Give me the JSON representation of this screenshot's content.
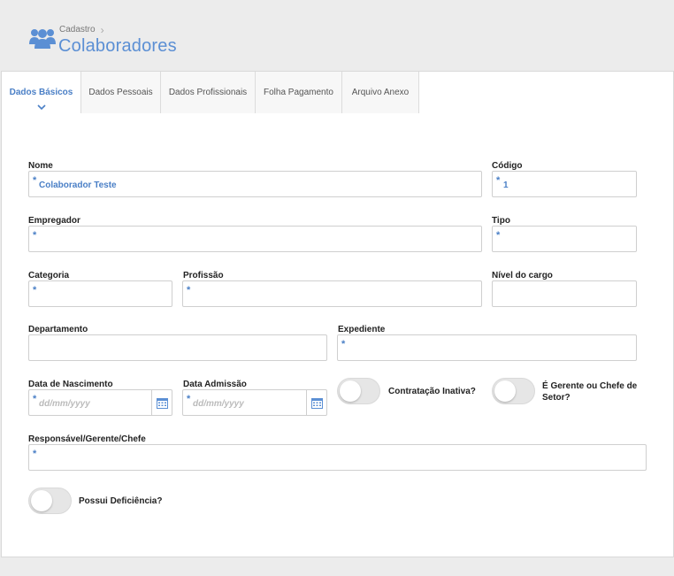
{
  "header": {
    "breadcrumb": "Cadastro",
    "title": "Colaboradores",
    "logo_icon": "users-icon",
    "accent_color": "#5b8fd4"
  },
  "tabs": [
    {
      "label": "Dados Básicos",
      "active": true
    },
    {
      "label": "Dados Pessoais",
      "active": false
    },
    {
      "label": "Dados Profissionais",
      "active": false
    },
    {
      "label": "Folha Pagamento",
      "active": false
    },
    {
      "label": "Arquivo Anexo",
      "active": false
    }
  ],
  "form": {
    "nome": {
      "label": "Nome",
      "value": "Colaborador Teste",
      "required": "*"
    },
    "codigo": {
      "label": "Código",
      "value": "1",
      "required": "*"
    },
    "empregador": {
      "label": "Empregador",
      "value": "",
      "required": "*"
    },
    "tipo": {
      "label": "Tipo",
      "value": "",
      "required": "*"
    },
    "categoria": {
      "label": "Categoria",
      "value": "",
      "required": "*"
    },
    "profissao": {
      "label": "Profissão",
      "value": "",
      "required": "*"
    },
    "nivel_cargo": {
      "label": "Nível do cargo",
      "value": ""
    },
    "departamento": {
      "label": "Departamento",
      "value": ""
    },
    "expediente": {
      "label": "Expediente",
      "value": "",
      "required": "*"
    },
    "data_nascimento": {
      "label": "Data de Nascimento",
      "placeholder": "dd/mm/yyyy",
      "required": "*"
    },
    "data_admissao": {
      "label": "Data Admissão",
      "placeholder": "dd/mm/yyyy",
      "required": "*"
    },
    "contratacao_inativa": {
      "label": "Contratação Inativa?",
      "checked": false
    },
    "gerente_chefe": {
      "label_line1": "É Gerente ou Chefe de",
      "label_line2": "Setor?",
      "checked": false
    },
    "responsavel": {
      "label": "Responsável/Gerente/Chefe",
      "value": "",
      "required": "*"
    },
    "possui_deficiencia": {
      "label": "Possui Deficiência?",
      "checked": false
    }
  }
}
